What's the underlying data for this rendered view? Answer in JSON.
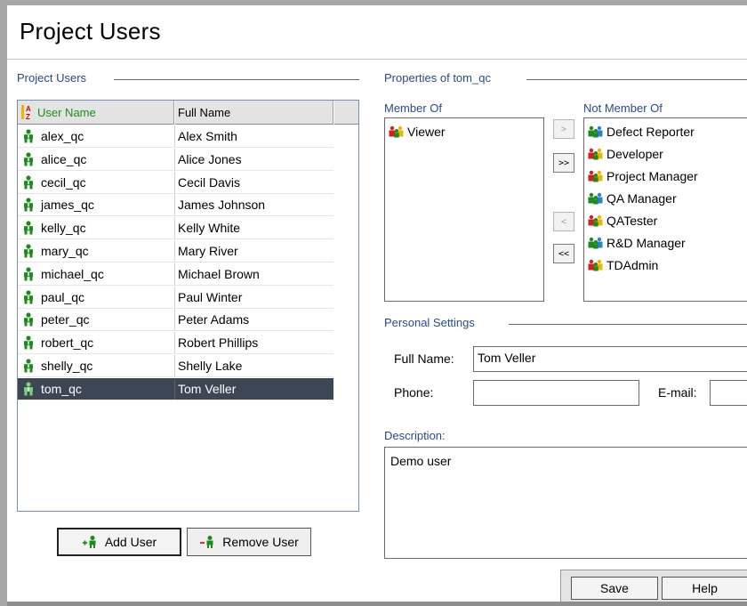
{
  "page": {
    "title": "Project Users"
  },
  "users_group": {
    "label": "Project Users"
  },
  "users_table": {
    "columns": [
      "User Name",
      "Full Name"
    ],
    "rows": [
      {
        "user": "alex_qc",
        "full": "Alex Smith"
      },
      {
        "user": "alice_qc",
        "full": "Alice Jones"
      },
      {
        "user": "cecil_qc",
        "full": "Cecil Davis"
      },
      {
        "user": "james_qc",
        "full": "James Johnson"
      },
      {
        "user": "kelly_qc",
        "full": "Kelly White"
      },
      {
        "user": "mary_qc",
        "full": "Mary River"
      },
      {
        "user": "michael_qc",
        "full": "Michael Brown"
      },
      {
        "user": "paul_qc",
        "full": "Paul Winter"
      },
      {
        "user": "peter_qc",
        "full": "Peter Adams"
      },
      {
        "user": "robert_qc",
        "full": "Robert Phillips"
      },
      {
        "user": "shelly_qc",
        "full": "Shelly Lake"
      },
      {
        "user": "tom_qc",
        "full": "Tom Veller",
        "selected": true
      }
    ],
    "sort_icon": "sort-az-icon",
    "user_icon": "user-icon"
  },
  "buttons": {
    "add_user": "Add User",
    "remove_user": "Remove User"
  },
  "properties": {
    "label": "Properties of tom_qc",
    "member_of_label": "Member Of",
    "not_member_of_label": "Not Member Of",
    "member_of": [
      "Viewer"
    ],
    "not_member_of": [
      "Defect Reporter",
      "Developer",
      "Project Manager",
      "QA Manager",
      "QATester",
      "R&D Manager",
      "TDAdmin"
    ],
    "group_icon": "group-icon",
    "move": {
      "add_one": ">",
      "add_all": ">>",
      "remove_one": "<",
      "remove_all": "<<"
    }
  },
  "personal": {
    "label": "Personal Settings",
    "full_name_label": "Full Name:",
    "full_name_value": "Tom Veller",
    "phone_label": "Phone:",
    "phone_value": "",
    "email_label": "E-mail:",
    "email_value": "",
    "description_label": "Description:",
    "description_value": "Demo user"
  },
  "footer": {
    "save": "Save",
    "help": "Help"
  },
  "colors": {
    "selected_row": "#3c4655",
    "group_label": "#2a4a86",
    "user_icon_green": "#1e8a1e",
    "header_sort_green": "#1f8a1f"
  }
}
